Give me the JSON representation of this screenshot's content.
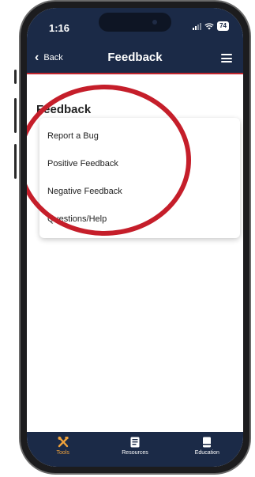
{
  "status_bar": {
    "time": "1:16",
    "battery": "74"
  },
  "nav": {
    "back_label": "Back",
    "title": "Feedback"
  },
  "page": {
    "heading": "Feedback"
  },
  "dropdown": {
    "items": [
      {
        "label": "Report a Bug"
      },
      {
        "label": "Positive Feedback"
      },
      {
        "label": "Negative Feedback"
      },
      {
        "label": "Questions/Help"
      }
    ]
  },
  "tabs": [
    {
      "label": "Tools",
      "icon": "tools-icon",
      "active": true
    },
    {
      "label": "Resources",
      "icon": "resources-icon",
      "active": false
    },
    {
      "label": "Education",
      "icon": "education-icon",
      "active": false
    }
  ],
  "colors": {
    "header": "#1b2a47",
    "header_accent": "#c0262d",
    "active_tab": "#f0a23b",
    "annotation": "#c51e2a"
  }
}
